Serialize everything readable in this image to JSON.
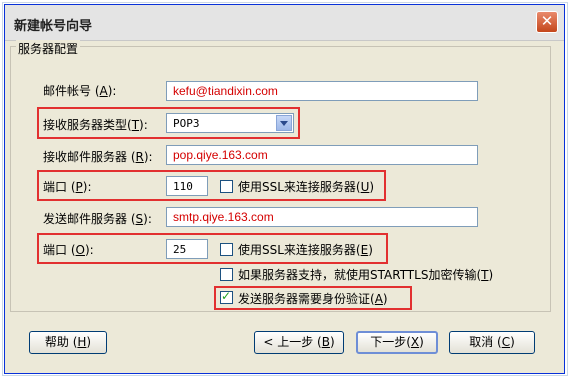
{
  "window": {
    "title": "新建帐号向导",
    "close_icon": "close-icon"
  },
  "group": {
    "label": "服务器配置"
  },
  "account": {
    "label": "邮件帐号",
    "key": "A",
    "value": "kefu@tiandixin.com"
  },
  "incoming_type": {
    "label": "接收服务器类型",
    "key": "T",
    "value": "POP3"
  },
  "incoming_server": {
    "label": "接收邮件服务器",
    "key": "R",
    "value": "pop.qiye.163.com"
  },
  "incoming_port": {
    "label": "端口",
    "key": "P",
    "value": "110",
    "ssl_label": "使用SSL来连接服务器",
    "ssl_key": "U",
    "ssl_checked": false
  },
  "outgoing_server": {
    "label": "发送邮件服务器",
    "key": "S",
    "value": "smtp.qiye.163.com"
  },
  "outgoing_port": {
    "label": "端口",
    "key": "O",
    "value": "25",
    "ssl_label": "使用SSL来连接服务器",
    "ssl_key": "E",
    "ssl_checked": false
  },
  "starttls": {
    "label": "如果服务器支持，就使用STARTTLS加密传输",
    "key": "T",
    "checked": false
  },
  "auth": {
    "label": "发送服务器需要身份验证",
    "key": "A",
    "checked": true
  },
  "buttons": {
    "help_label": "帮助",
    "help_key": "H",
    "back_label": "< 上一步",
    "back_key": "B",
    "next_label": "下一步",
    "next_key": "X",
    "cancel_label": "取消",
    "cancel_key": "C"
  },
  "colors": {
    "highlight_border": "#e23030",
    "field_value_text": "#d40000",
    "dialog_bg": "#ece9d8"
  }
}
